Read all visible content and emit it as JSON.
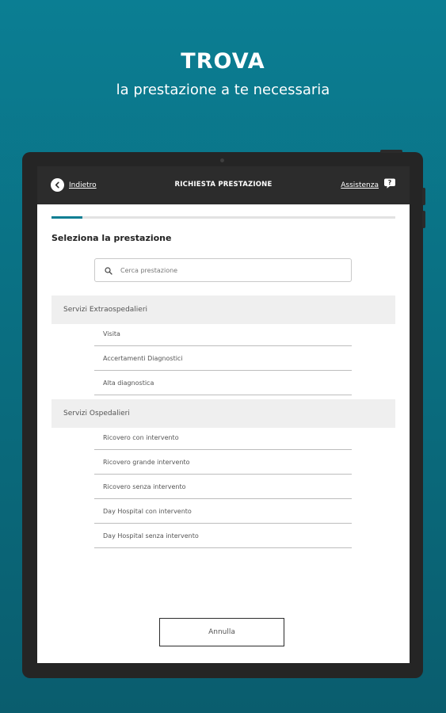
{
  "hero": {
    "title": "TROVA",
    "subtitle": "la prestazione a te necessaria"
  },
  "appbar": {
    "back_label": "Indietro",
    "title": "RICHIESTA PRESTAZIONE",
    "assist_label": "Assistenza"
  },
  "progress": {
    "fraction": 0.09
  },
  "page": {
    "section_title": "Seleziona la prestazione",
    "search_placeholder": "Cerca prestazione"
  },
  "groups": [
    {
      "label": "Servizi Extraospedalieri",
      "items": [
        "Visita",
        "Accertamenti Diagnostici",
        "Alta diagnostica"
      ]
    },
    {
      "label": "Servizi Ospedalieri",
      "items": [
        "Ricovero con intervento",
        "Ricovero grande intervento",
        "Ricovero senza intervento",
        "Day Hospital con intervento",
        "Day Hospital senza intervento"
      ]
    }
  ],
  "footer": {
    "cancel_label": "Annulla"
  },
  "colors": {
    "accent": "#0b7e93",
    "appbar": "#2c2c2c",
    "group_bg": "#efefef"
  },
  "icons": {
    "back": "chevron-left-icon",
    "assist": "chat-help-icon",
    "search": "search-icon"
  }
}
